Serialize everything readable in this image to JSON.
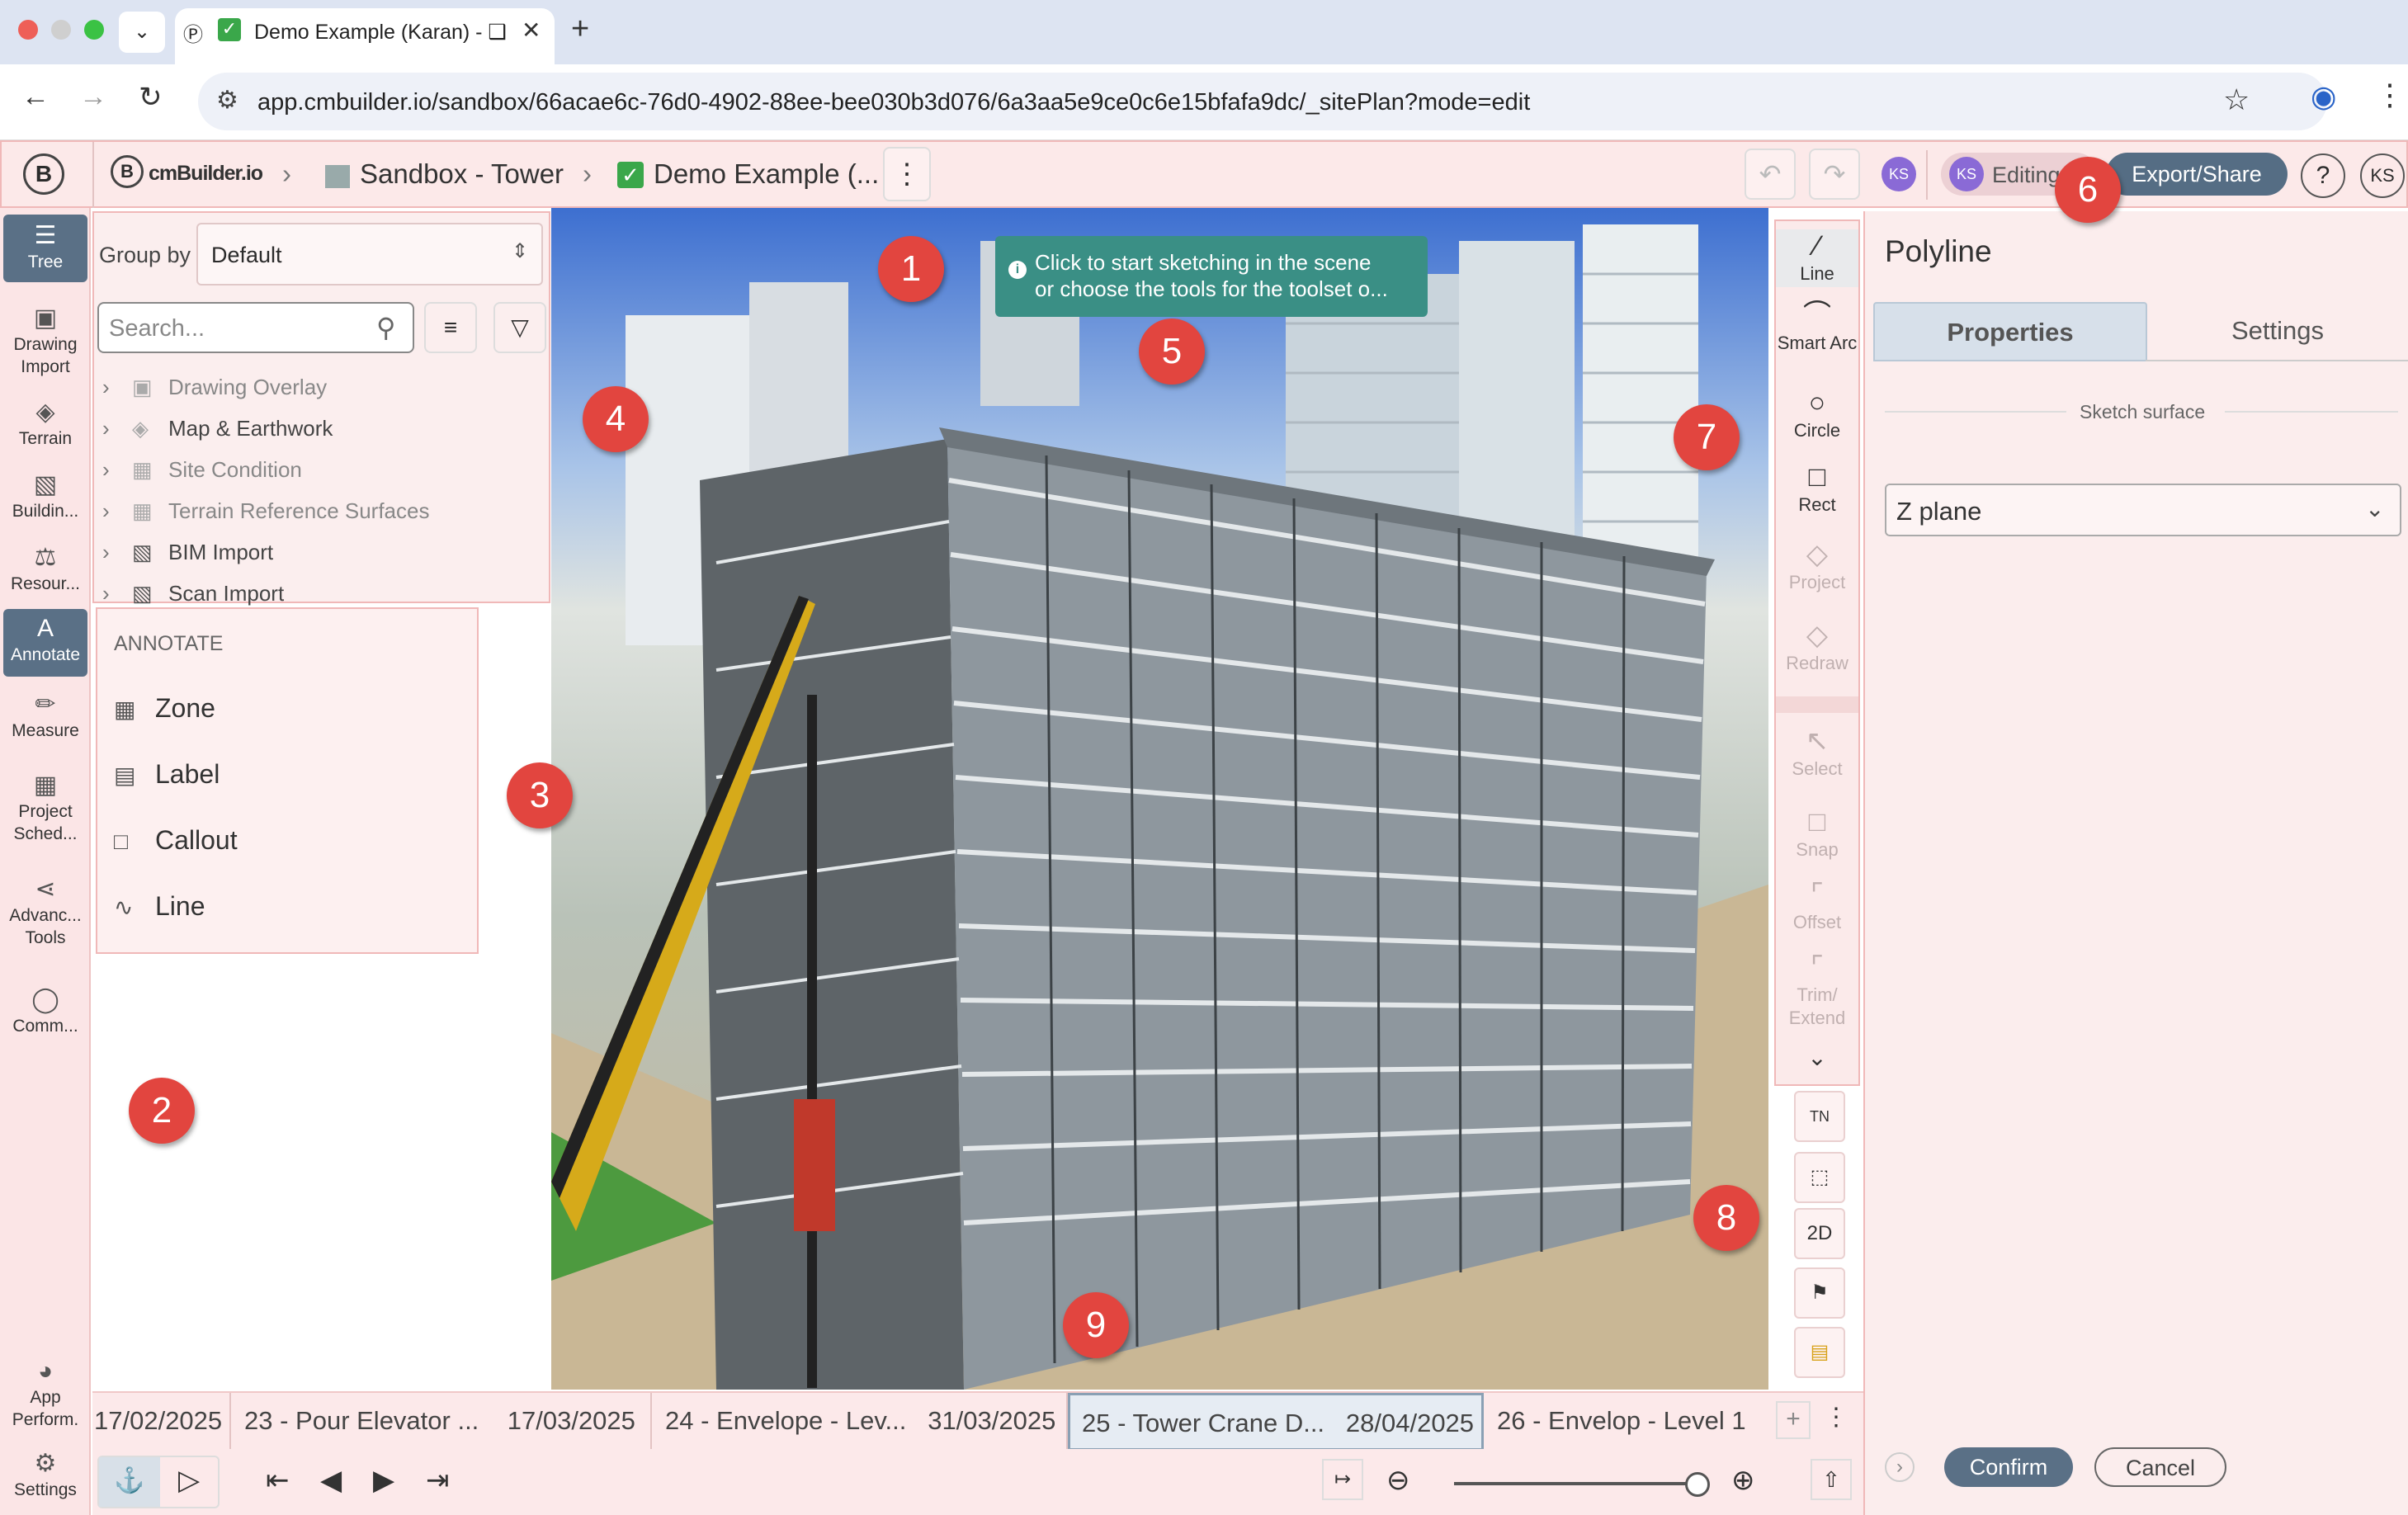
{
  "browser": {
    "tab_title": "Demo Example (Karan) - ❑",
    "new_tab": "+",
    "url": "app.cmbuilder.io/sandbox/66acae6c-76d0-4902-88ee-bee030b3d076/6a3aa5e9ce0c6e15bfafa9dc/_sitePlan?mode=edit"
  },
  "header": {
    "logo_text": "cmBuilder.io",
    "crumb1": "Sandbox - Tower",
    "crumb2": "Demo Example (...",
    "editing_label": "Editing",
    "export_label": "Export/Share",
    "avatar_initials": "KS",
    "help": "?"
  },
  "rail": {
    "items": [
      {
        "label": "Tree",
        "icon": "tree-icon"
      },
      {
        "label": "Drawing Import",
        "icon": "image-icon"
      },
      {
        "label": "Terrain",
        "icon": "layers-icon"
      },
      {
        "label": "Buildin...",
        "icon": "building-icon"
      },
      {
        "label": "Resour...",
        "icon": "resources-icon"
      },
      {
        "label": "Annotate",
        "icon": "annotate-icon"
      },
      {
        "label": "Measure",
        "icon": "ruler-icon"
      },
      {
        "label": "Project Sched...",
        "icon": "calendar-icon"
      },
      {
        "label": "Advanc... Tools",
        "icon": "tools-icon"
      },
      {
        "label": "Comm...",
        "icon": "comment-icon"
      },
      {
        "label": "App Perform.",
        "icon": "gauge-icon"
      },
      {
        "label": "Settings",
        "icon": "gear-icon"
      }
    ]
  },
  "tree": {
    "groupby_label": "Group by",
    "groupby_value": "Default",
    "search_placeholder": "Search...",
    "rows": [
      "Drawing Overlay",
      "Map & Earthwork",
      "Site Condition",
      "Terrain Reference Surfaces",
      "BIM Import",
      "Scan Import"
    ]
  },
  "annotate": {
    "heading": "ANNOTATE",
    "items": [
      "Zone",
      "Label",
      "Callout",
      "Line"
    ]
  },
  "hint": {
    "line1": "Click to start sketching in the scene",
    "line2": "or choose the tools for the toolset o..."
  },
  "toolbar": {
    "items": [
      {
        "label": "Line",
        "enabled": true
      },
      {
        "label": "Smart Arc",
        "enabled": true
      },
      {
        "label": "Circle",
        "enabled": true
      },
      {
        "label": "Rect",
        "enabled": true
      },
      {
        "label": "Project",
        "enabled": false
      },
      {
        "label": "Redraw",
        "enabled": false
      },
      {
        "label": "Select",
        "enabled": false
      },
      {
        "label": "Snap",
        "enabled": false
      },
      {
        "label": "Offset",
        "enabled": false
      },
      {
        "label": "Trim/ Extend",
        "enabled": false
      }
    ],
    "view_buttons": [
      "TN",
      "⬚",
      "2D",
      "⚑",
      "▤"
    ]
  },
  "panel": {
    "title": "Polyline",
    "tab_properties": "Properties",
    "tab_settings": "Settings",
    "section": "Sketch surface",
    "surface_value": "Z plane",
    "confirm": "Confirm",
    "cancel": "Cancel"
  },
  "timeline": {
    "segments": [
      {
        "text": "17/02/2025"
      },
      {
        "text": "23 - Pour Elevator ...    17/03/2025"
      },
      {
        "text": "24 - Envelope - Lev...   31/03/2025"
      },
      {
        "text": "25 - Tower Crane D...   28/04/2025"
      },
      {
        "text": "26 - Envelop - Level 1"
      }
    ]
  },
  "callouts": [
    "1",
    "2",
    "3",
    "4",
    "5",
    "6",
    "7",
    "8",
    "9"
  ],
  "colors": {
    "accent": "#5a7086",
    "callout": "#e2453f",
    "panel_bg": "#fbeded",
    "hint_bg": "#3a8f85"
  }
}
